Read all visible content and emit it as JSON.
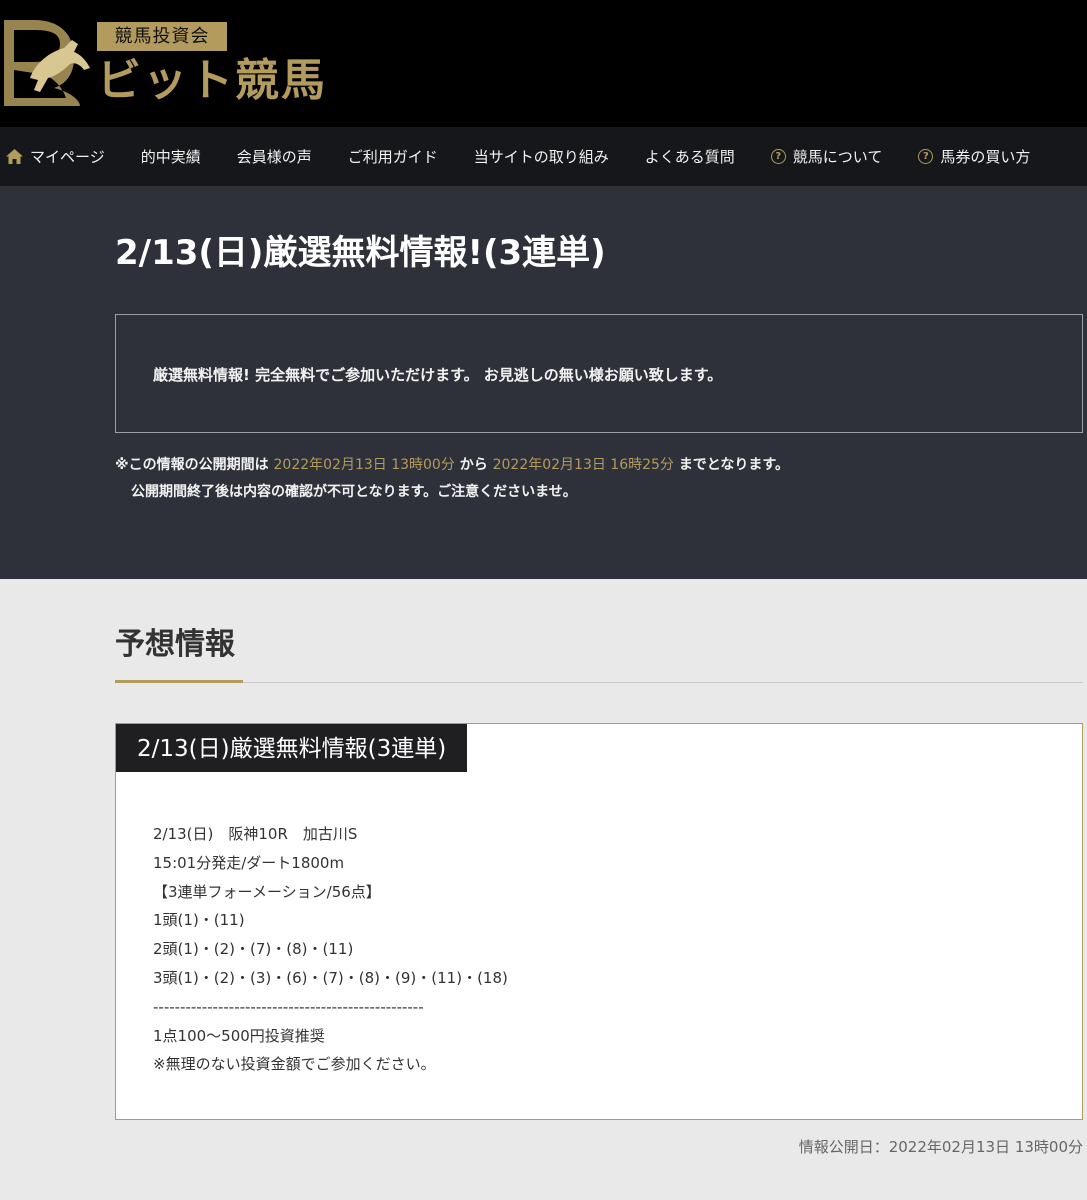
{
  "brand": {
    "badge": "競馬投資会",
    "name": "ビット競馬",
    "colors": {
      "gold": "#b39b5d",
      "header_bg": "#000000",
      "nav_bg": "#16171a",
      "hero_bg": "#2e3139"
    }
  },
  "nav": {
    "items": [
      {
        "label": "マイページ",
        "icon": "home-icon"
      },
      {
        "label": "的中実績",
        "icon": ""
      },
      {
        "label": "会員様の声",
        "icon": ""
      },
      {
        "label": "ご利用ガイド",
        "icon": ""
      },
      {
        "label": "当サイトの取り組み",
        "icon": ""
      },
      {
        "label": "よくある質問",
        "icon": ""
      },
      {
        "label": "競馬について",
        "icon": "question-circle-icon"
      },
      {
        "label": "馬券の買い方",
        "icon": "question-circle-icon"
      }
    ]
  },
  "hero": {
    "title": "2/13(日)厳選無料情報!(3連単)",
    "notice": "厳選無料情報! 完全無料でご参加いただけます。 お見逃しの無い様お願い致します。",
    "period": {
      "prefix": "※この情報の公開期間は",
      "start": "2022年02月13日 13時00分",
      "middle": "から",
      "end": "2022年02月13日 16時25分",
      "suffix": "までとなります。",
      "line2": "公開期間終了後は内容の確認が不可となります。ご注意くださいませ。"
    }
  },
  "prediction": {
    "section_title": "予想情報",
    "card_title": "2/13(日)厳選無料情報(3連単)",
    "lines": [
      "2/13(日)　阪神10R　加古川S",
      "15:01分発走/ダート1800m",
      "【3連単フォーメーション/56点】",
      "1頭(1)・(11)",
      "2頭(1)・(2)・(7)・(8)・(11)",
      "3頭(1)・(2)・(3)・(6)・(7)・(8)・(9)・(11)・(18)",
      "--------------------------------------------------",
      "1点100～500円投資推奨",
      "※無理のない投資金額でご参加ください。"
    ],
    "published": "情報公開日：2022年02月13日 13時00分"
  }
}
